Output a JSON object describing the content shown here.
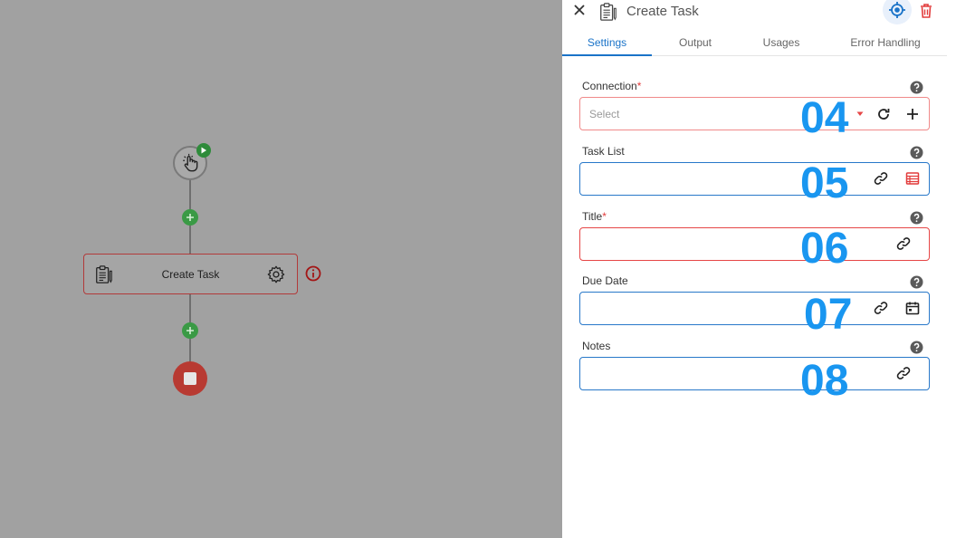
{
  "canvas": {
    "node_label": "Create Task"
  },
  "panel": {
    "title": "Create Task",
    "tabs": [
      {
        "label": "Settings",
        "active": true
      },
      {
        "label": "Output",
        "active": false
      },
      {
        "label": "Usages",
        "active": false
      },
      {
        "label": "Error Handling",
        "active": false
      }
    ],
    "fields": {
      "connection": {
        "label": "Connection",
        "required_mark": "*",
        "placeholder": "Select",
        "value": "",
        "marker": "04"
      },
      "task_list": {
        "label": "Task List",
        "value": "",
        "marker": "05"
      },
      "title": {
        "label": "Title",
        "required_mark": "*",
        "value": "",
        "marker": "06"
      },
      "due_date": {
        "label": "Due Date",
        "value": "",
        "marker": "07"
      },
      "notes": {
        "label": "Notes",
        "value": "",
        "marker": "08"
      }
    }
  },
  "colors": {
    "accent_blue": "#1a73c8",
    "error_red": "#e64646",
    "success_green": "#3a9a45",
    "marker_blue": "#1996f0"
  },
  "icons": [
    "close-icon",
    "task-icon",
    "locate-icon",
    "delete-icon",
    "help-icon",
    "dropdown-arrow-icon",
    "refresh-icon",
    "plus-icon",
    "link-icon",
    "table-icon",
    "calendar-icon",
    "gear-icon",
    "info-icon",
    "play-icon",
    "pointer-icon",
    "stop-icon"
  ]
}
